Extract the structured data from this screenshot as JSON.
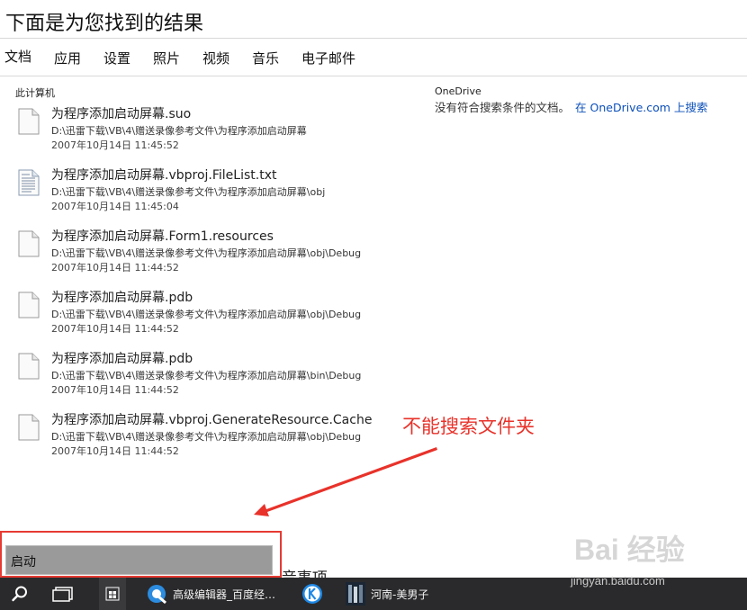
{
  "header": {
    "title": "下面是为您找到的结果"
  },
  "tabs": [
    {
      "label": "文档"
    },
    {
      "label": "应用"
    },
    {
      "label": "设置"
    },
    {
      "label": "照片"
    },
    {
      "label": "视频"
    },
    {
      "label": "音乐"
    },
    {
      "label": "电子邮件"
    }
  ],
  "local": {
    "heading": "此计算机",
    "results": [
      {
        "name": "为程序添加启动屏幕.suo",
        "path": "D:\\迅雷下载\\VB\\4\\赠送录像参考文件\\为程序添加启动屏幕",
        "date": "2007年10月14日 11:45:52",
        "icon": "document-icon"
      },
      {
        "name": "为程序添加启动屏幕.vbproj.FileList.txt",
        "path": "D:\\迅雷下载\\VB\\4\\赠送录像参考文件\\为程序添加启动屏幕\\obj",
        "date": "2007年10月14日 11:45:04",
        "icon": "text-file-icon"
      },
      {
        "name": "为程序添加启动屏幕.Form1.resources",
        "path": "D:\\迅雷下载\\VB\\4\\赠送录像参考文件\\为程序添加启动屏幕\\obj\\Debug",
        "date": "2007年10月14日 11:44:52",
        "icon": "document-icon"
      },
      {
        "name": "为程序添加启动屏幕.pdb",
        "path": "D:\\迅雷下载\\VB\\4\\赠送录像参考文件\\为程序添加启动屏幕\\obj\\Debug",
        "date": "2007年10月14日 11:44:52",
        "icon": "document-icon"
      },
      {
        "name": "为程序添加启动屏幕.pdb",
        "path": "D:\\迅雷下载\\VB\\4\\赠送录像参考文件\\为程序添加启动屏幕\\bin\\Debug",
        "date": "2007年10月14日 11:44:52",
        "icon": "document-icon"
      },
      {
        "name": "为程序添加启动屏幕.vbproj.GenerateResource.Cache",
        "path": "D:\\迅雷下载\\VB\\4\\赠送录像参考文件\\为程序添加启动屏幕\\obj\\Debug",
        "date": "2007年10月14日 11:44:52",
        "icon": "document-icon"
      }
    ]
  },
  "onedrive": {
    "heading": "OneDrive",
    "message": "没有符合搜索条件的文档。",
    "link": "在 OneDrive.com 上搜索"
  },
  "annotation": {
    "text": "不能搜索文件夹",
    "color": "#e8322a"
  },
  "cut_text": "i音事项",
  "search_box": {
    "value": "启动"
  },
  "taskbar": {
    "search_icon": "search-icon",
    "task_view_icon": "task-view-icon",
    "store_icon": "store-icon",
    "app1_label": "高级编辑器_百度经…",
    "app2_icon": "k-app-icon",
    "app3_label": "河南-美男子"
  },
  "watermark": {
    "logo": "Bai 经验",
    "url": "jingyan.baidu.com"
  },
  "colors": {
    "accent_link": "#0b4fb8",
    "taskbar": "#2a2a2c",
    "highlight_border": "#e63a32"
  }
}
